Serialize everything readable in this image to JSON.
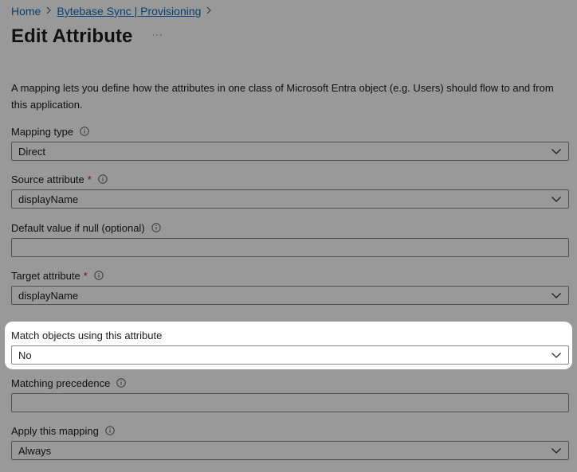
{
  "breadcrumb": {
    "home": "Home",
    "parent": "Bytebase Sync | Provisioning"
  },
  "page_title": "Edit Attribute",
  "more_label": "···",
  "description": "A mapping lets you define how the attributes in one class of Microsoft Entra object (e.g. Users) should flow to and from this application.",
  "fields": {
    "mapping_type": {
      "label": "Mapping type",
      "value": "Direct"
    },
    "source_attribute": {
      "label": "Source attribute",
      "required": "*",
      "value": "displayName"
    },
    "default_value": {
      "label": "Default value if null (optional)",
      "value": ""
    },
    "target_attribute": {
      "label": "Target attribute",
      "required": "*",
      "value": "displayName"
    },
    "match_objects": {
      "label": "Match objects using this attribute",
      "value": "No"
    },
    "matching_precedence": {
      "label": "Matching precedence",
      "value": ""
    },
    "apply_mapping": {
      "label": "Apply this mapping",
      "value": "Always"
    }
  },
  "colors": {
    "link": "#0f6cbd",
    "required": "#c50f1f",
    "border": "#8a8886"
  }
}
